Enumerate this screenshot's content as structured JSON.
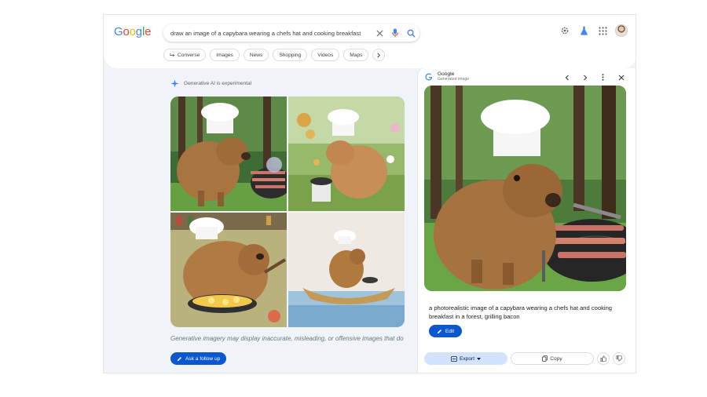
{
  "header": {
    "logo_letters": [
      {
        "ch": "G",
        "color": "#4285f4"
      },
      {
        "ch": "o",
        "color": "#ea4335"
      },
      {
        "ch": "o",
        "color": "#fbbc05"
      },
      {
        "ch": "g",
        "color": "#4285f4"
      },
      {
        "ch": "l",
        "color": "#34a853"
      },
      {
        "ch": "e",
        "color": "#ea4335"
      }
    ],
    "search_query": "draw an image of a capybara wearing a chefs hat and cooking breakfast",
    "icons": [
      "close-icon",
      "mic-icon",
      "search-icon",
      "gear-icon",
      "labs-icon",
      "apps-icon"
    ]
  },
  "chips": [
    {
      "label": "Converse",
      "icon": "converse-arrow-icon"
    },
    {
      "label": "Images"
    },
    {
      "label": "News"
    },
    {
      "label": "Shopping"
    },
    {
      "label": "Videos"
    },
    {
      "label": "Maps"
    }
  ],
  "results": {
    "ai_label": "Generative AI is experimental",
    "disclaimer": "Generative imagery may display inaccurate, misleading, or offensive images that do",
    "follow_up": "Ask a follow up"
  },
  "panel": {
    "source": "Google",
    "source_sub": "Generated image",
    "caption": "a photorealistic image of a capybara wearing a chefs hat and cooking breakfast in a forest, grilling bacon",
    "edit_label": "Edit",
    "export_label": "Export",
    "copy_label": "Copy"
  },
  "colors": {
    "accent": "#0b57d0",
    "tonal": "#d3e3fd",
    "background": "#f0f4f9"
  }
}
